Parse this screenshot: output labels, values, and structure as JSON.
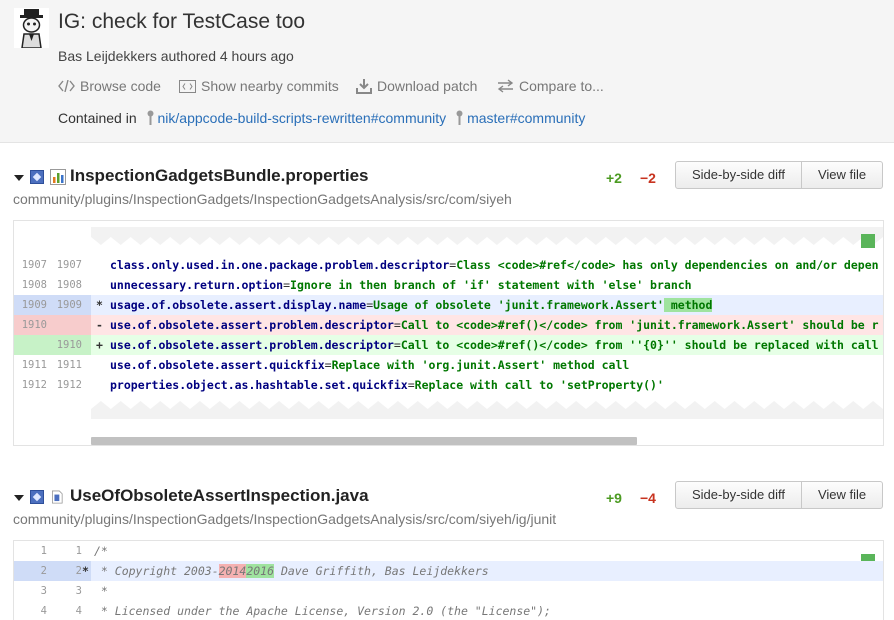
{
  "commit": {
    "title": "IG: check for TestCase too",
    "author_line": "Bas Leijdekkers authored 4 hours ago",
    "actions": [
      "Browse code",
      "Show nearby commits",
      "Download patch",
      "Compare to..."
    ],
    "contained_label": "Contained in",
    "refs": [
      "nik/appcode-build-scripts-rewritten#community",
      "master#community"
    ]
  },
  "buttons": {
    "side_by_side": "Side-by-side diff",
    "view_file": "View file"
  },
  "files": [
    {
      "name": "InspectionGadgetsBundle.properties",
      "path": "community/plugins/InspectionGadgets/InspectionGadgetsAnalysis/src/com/siyeh",
      "added": "+2",
      "removed": "−2",
      "lines": [
        {
          "old": "1907",
          "new": "1907",
          "mark": "",
          "key": "class.only.used.in.one.package.problem.descriptor",
          "eq": "=",
          "val": "Class <code>#ref</code> has only dependencies on and/or depen"
        },
        {
          "old": "1908",
          "new": "1908",
          "mark": "",
          "key": "unnecessary.return.option",
          "eq": "=",
          "val": "Ignore in then branch of 'if' statement with 'else' branch"
        },
        {
          "old": "1909",
          "new": "1909",
          "mark": "*",
          "key": "usage.of.obsolete.assert.display.name",
          "eq": "=",
          "val": "Usage of obsolete 'junit.framework.Assert'",
          "hl": " method"
        },
        {
          "old": "1910",
          "new": "",
          "mark": "-",
          "key": "use.of.obsolete.assert.problem.descriptor",
          "eq": "=",
          "val": "Call to <code>#ref()</code> from 'junit.framework.Assert' should be r"
        },
        {
          "old": "",
          "new": "1910",
          "mark": "+",
          "key": "use.of.obsolete.assert.problem.descriptor",
          "eq": "=",
          "val": "Call to <code>#ref()</code> from ''{0}'' should be replaced with call"
        },
        {
          "old": "1911",
          "new": "1911",
          "mark": "",
          "key": "use.of.obsolete.assert.quickfix",
          "eq": "=",
          "val": "Replace with 'org.junit.Assert' method call"
        },
        {
          "old": "1912",
          "new": "1912",
          "mark": "",
          "key": "properties.object.as.hashtable.set.quickfix",
          "eq": "=",
          "val": "Replace with call to 'setProperty()'"
        }
      ]
    },
    {
      "name": "UseOfObsoleteAssertInspection.java",
      "path": "community/plugins/InspectionGadgets/InspectionGadgetsAnalysis/src/com/siyeh/ig/junit",
      "added": "+9",
      "removed": "−4",
      "lines": [
        {
          "old": "1",
          "new": "1",
          "mark": "",
          "text": "/*"
        },
        {
          "old": "2",
          "new": "2",
          "mark": "*",
          "pre": " * Copyright 2003-",
          "del": "2014",
          "add": "2016",
          "post": " Dave Griffith, Bas Leijdekkers"
        },
        {
          "old": "3",
          "new": "3",
          "mark": "",
          "text": " *"
        },
        {
          "old": "4",
          "new": "4",
          "mark": "",
          "text": " * Licensed under the Apache License, Version 2.0 (the \"License\");"
        }
      ]
    }
  ]
}
